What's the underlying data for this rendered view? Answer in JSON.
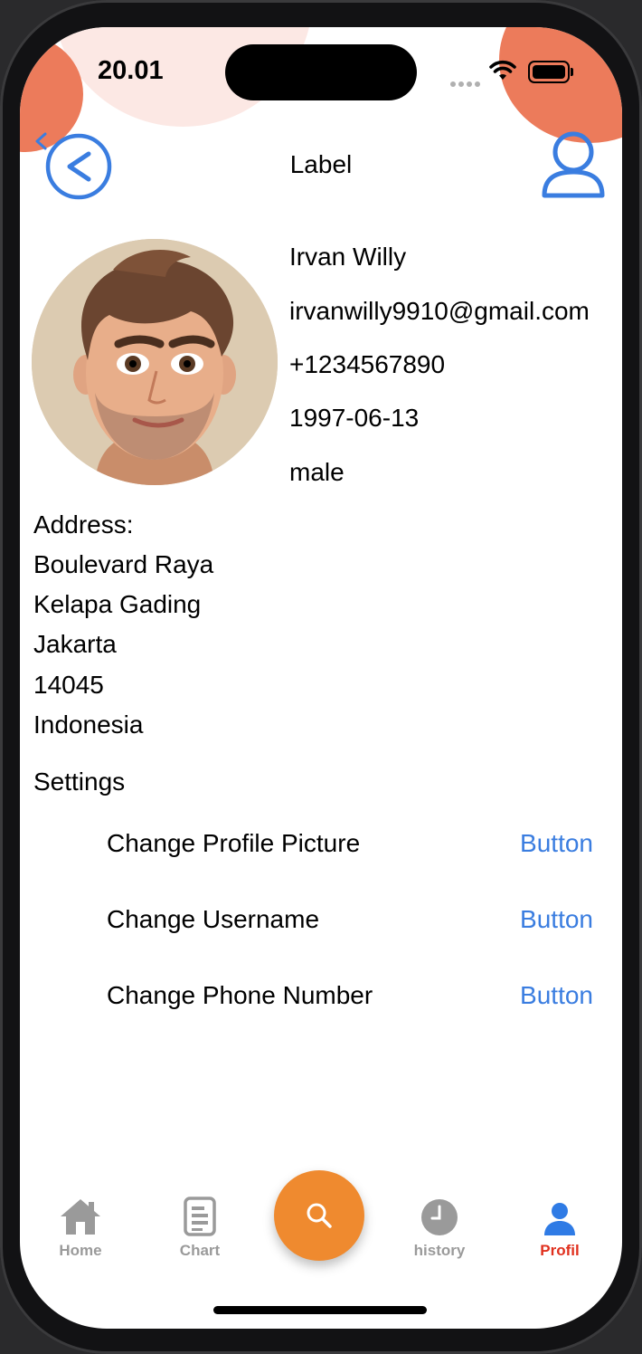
{
  "status": {
    "time": "20.01"
  },
  "nav": {
    "title": "Label"
  },
  "profile": {
    "name": "Irvan Willy",
    "email": "irvanwilly9910@gmail.com",
    "phone": "+1234567890",
    "birthdate": "1997-06-13",
    "gender": "male"
  },
  "address": {
    "heading": "Address:",
    "lines": [
      "Boulevard Raya",
      "Kelapa Gading",
      "Jakarta",
      "14045",
      "Indonesia"
    ]
  },
  "settings": {
    "heading": "Settings",
    "items": [
      {
        "label": "Change Profile Picture",
        "button": "Button"
      },
      {
        "label": "Change Username",
        "button": "Button"
      },
      {
        "label": "Change Phone Number",
        "button": "Button"
      }
    ]
  },
  "tabbar": {
    "tabs": [
      {
        "label": "Home",
        "icon": "house-icon"
      },
      {
        "label": "Chart",
        "icon": "document-icon"
      },
      {
        "label": "history",
        "icon": "clock-icon"
      },
      {
        "label": "Profil",
        "icon": "person-icon",
        "active": true
      }
    ],
    "center_icon": "search-icon"
  },
  "colors": {
    "accent_blue": "#3a7de0",
    "fab_orange": "#ef8a2f",
    "blob_orange": "#ec7b5b",
    "active_tab": "#e0301e",
    "inactive_tab": "#9a9a9a"
  }
}
